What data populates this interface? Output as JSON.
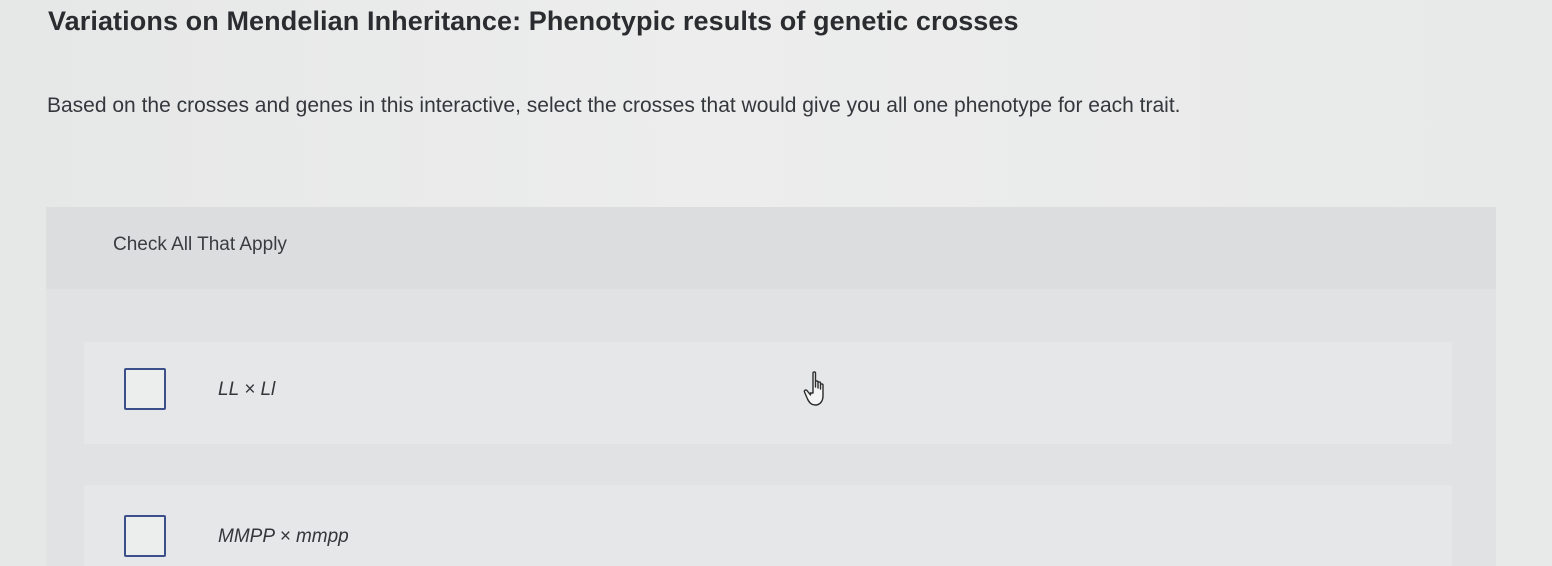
{
  "question": {
    "title": "Variations on Mendelian Inheritance: Phenotypic results of genetic crosses",
    "prompt": "Based on the crosses and genes in this interactive, select the crosses that would give you all one phenotype for each trait."
  },
  "panel": {
    "instruction": "Check All That Apply",
    "options": [
      {
        "label": "LL × Ll",
        "checked": false
      },
      {
        "label": "MMPP × mmpp",
        "checked": false
      }
    ]
  },
  "icons": {
    "cursor": "hand-pointer-icon"
  },
  "colors": {
    "checkbox_border": "#3c4f8a",
    "background": "#e9eaea",
    "panel": "#e1e2e3"
  }
}
